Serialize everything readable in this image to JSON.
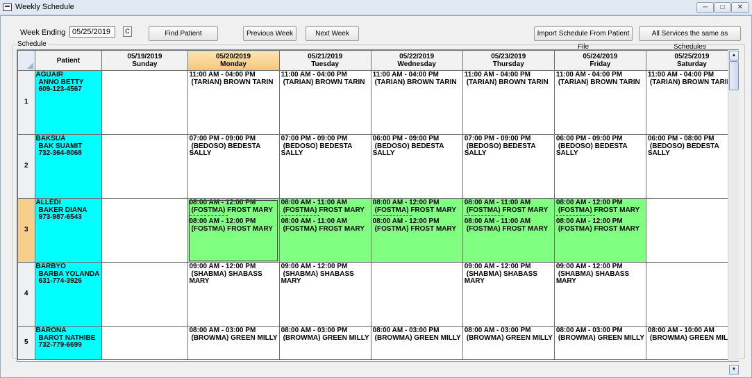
{
  "window": {
    "title": "Weekly Schedule"
  },
  "toolbar": {
    "week_ending_label": "Week Ending",
    "week_ending_value": "05/25/2019",
    "c_label": "C",
    "find_patient": "Find Patient",
    "previous_week": "Previous Week",
    "next_week": "Next Week",
    "import_schedule": "Import Schedule From Patient File",
    "all_services_same": "All Services the same as Schedules"
  },
  "schedule_label": "Schedule",
  "grid": {
    "patient_header": "Patient",
    "days": [
      {
        "date": "05/19/2019",
        "day": "Sunday"
      },
      {
        "date": "05/20/2019",
        "day": "Monday"
      },
      {
        "date": "05/21/2019",
        "day": "Tuesday"
      },
      {
        "date": "05/22/2019",
        "day": "Wednesday"
      },
      {
        "date": "05/23/2019",
        "day": "Thursday"
      },
      {
        "date": "05/24/2019",
        "day": "Friday"
      },
      {
        "date": "05/25/2019",
        "day": "Saturday"
      }
    ],
    "rows": [
      {
        "num": "1",
        "patient": {
          "code": "AGUAIR",
          "name": "ANNO BETTY",
          "phone": "609-123-4567"
        },
        "cells": [
          [],
          [
            {
              "time": "11:00 AM - 04:00 PM",
              "aide": "(TARIAN) BROWN TARIN",
              "aide2": ""
            }
          ],
          [
            {
              "time": "11:00 AM - 04:00 PM",
              "aide": "(TARIAN) BROWN TARIN",
              "aide2": ""
            }
          ],
          [
            {
              "time": "11:00 AM - 04:00 PM",
              "aide": "(TARIAN) BROWN TARIN",
              "aide2": ""
            }
          ],
          [
            {
              "time": "11:00 AM - 04:00 PM",
              "aide": "(TARIAN) BROWN TARIN",
              "aide2": ""
            }
          ],
          [
            {
              "time": "11:00 AM - 04:00 PM",
              "aide": "(TARIAN) BROWN TARIN",
              "aide2": ""
            }
          ],
          [
            {
              "time": "11:00 AM - 04:00 PM",
              "aide": "(TARIAN) BROWN TARIN",
              "aide2": ""
            }
          ]
        ]
      },
      {
        "num": "2",
        "patient": {
          "code": "BAKSUA",
          "name": "BAK SUAMIT",
          "phone": "732-364-8068"
        },
        "cells": [
          [],
          [
            {
              "time": "07:00 PM - 09:00 PM",
              "aide": "(BEDOSO) BEDESTA",
              "aide2": "SALLY"
            }
          ],
          [
            {
              "time": "07:00 PM - 09:00 PM",
              "aide": "(BEDOSO) BEDESTA",
              "aide2": "SALLY"
            }
          ],
          [
            {
              "time": "06:00 PM - 09:00 PM",
              "aide": "(BEDOSO) BEDESTA",
              "aide2": "SALLY"
            }
          ],
          [
            {
              "time": "07:00 PM - 09:00 PM",
              "aide": "(BEDOSO) BEDESTA",
              "aide2": "SALLY"
            }
          ],
          [
            {
              "time": "06:00 PM - 09:00 PM",
              "aide": "(BEDOSO) BEDESTA",
              "aide2": "SALLY"
            }
          ],
          [
            {
              "time": "06:00 PM - 08:00 PM",
              "aide": "(BEDOSO) BEDESTA",
              "aide2": "SALLY"
            }
          ]
        ]
      },
      {
        "num": "3",
        "patient": {
          "code": "ALLEDI",
          "name": "BAKER DIANA",
          "phone": "973-987-6543"
        },
        "cells": [
          [],
          [
            {
              "time": "08:00 AM - 12:00 PM",
              "aide": "(FOSTMA) FROST MARY",
              "aide2": ""
            },
            {
              "time": "08:00 AM - 12:00 PM",
              "aide": "(FOSTMA) FROST MARY",
              "aide2": ""
            }
          ],
          [
            {
              "time": "08:00 AM - 11:00 AM",
              "aide": "(FOSTMA) FROST MARY",
              "aide2": ""
            },
            {
              "time": "08:00 AM - 11:00 AM",
              "aide": "(FOSTMA) FROST MARY",
              "aide2": ""
            }
          ],
          [
            {
              "time": "08:00 AM - 12:00 PM",
              "aide": "(FOSTMA) FROST MARY",
              "aide2": ""
            },
            {
              "time": "08:00 AM - 12:00 PM",
              "aide": "(FOSTMA) FROST MARY",
              "aide2": ""
            }
          ],
          [
            {
              "time": "08:00 AM - 11:00 AM",
              "aide": "(FOSTMA) FROST MARY",
              "aide2": ""
            },
            {
              "time": "08:00 AM - 11:00 AM",
              "aide": "(FOSTMA) FROST MARY",
              "aide2": ""
            }
          ],
          [
            {
              "time": "08:00 AM - 12:00 PM",
              "aide": "(FOSTMA) FROST MARY",
              "aide2": ""
            },
            {
              "time": "08:00 AM - 12:00 PM",
              "aide": "(FOSTMA) FROST MARY",
              "aide2": ""
            }
          ],
          []
        ]
      },
      {
        "num": "4",
        "patient": {
          "code": "BARBYO",
          "name": "BARBA YOLANDA",
          "phone": "631-774-3926"
        },
        "cells": [
          [],
          [
            {
              "time": "09:00 AM - 12:00 PM",
              "aide": "(SHABMA) SHABASS",
              "aide2": "MARY"
            }
          ],
          [
            {
              "time": "09:00 AM - 12:00 PM",
              "aide": "(SHABMA) SHABASS",
              "aide2": "MARY"
            }
          ],
          [],
          [
            {
              "time": "09:00 AM - 12:00 PM",
              "aide": "(SHABMA) SHABASS",
              "aide2": "MARY"
            }
          ],
          [
            {
              "time": "09:00 AM - 12:00 PM",
              "aide": "(SHABMA) SHABASS",
              "aide2": "MARY"
            }
          ],
          []
        ]
      },
      {
        "num": "5",
        "patient": {
          "code": "BARONA",
          "name": "BAROT NATHIBE",
          "phone": "732-779-6699"
        },
        "cells": [
          [],
          [
            {
              "time": "08:00 AM - 03:00 PM",
              "aide": "(BROWMA) GREEN MILLY",
              "aide2": ""
            }
          ],
          [
            {
              "time": "08:00 AM - 03:00 PM",
              "aide": "(BROWMA) GREEN MILLY",
              "aide2": ""
            }
          ],
          [
            {
              "time": "08:00 AM - 03:00 PM",
              "aide": "(BROWMA) GREEN MILLY",
              "aide2": ""
            }
          ],
          [
            {
              "time": "08:00 AM - 03:00 PM",
              "aide": "(BROWMA) GREEN MILLY",
              "aide2": ""
            }
          ],
          [
            {
              "time": "08:00 AM - 03:00 PM",
              "aide": "(BROWMA) GREEN MILLY",
              "aide2": ""
            }
          ],
          [
            {
              "time": "08:00 AM - 10:00 AM",
              "aide": "(BROWMA) GREEN MILLY",
              "aide2": ""
            }
          ]
        ]
      }
    ]
  },
  "colors": {
    "patient_bg": "#00ffff",
    "highlight_green": "#80ff80",
    "selected_header": "#f6c675"
  },
  "icons": {
    "minimize": "minimize-icon",
    "maximize": "maximize-icon",
    "close": "close-icon",
    "scroll_up": "scroll-up-icon",
    "scroll_down": "scroll-down-icon"
  }
}
